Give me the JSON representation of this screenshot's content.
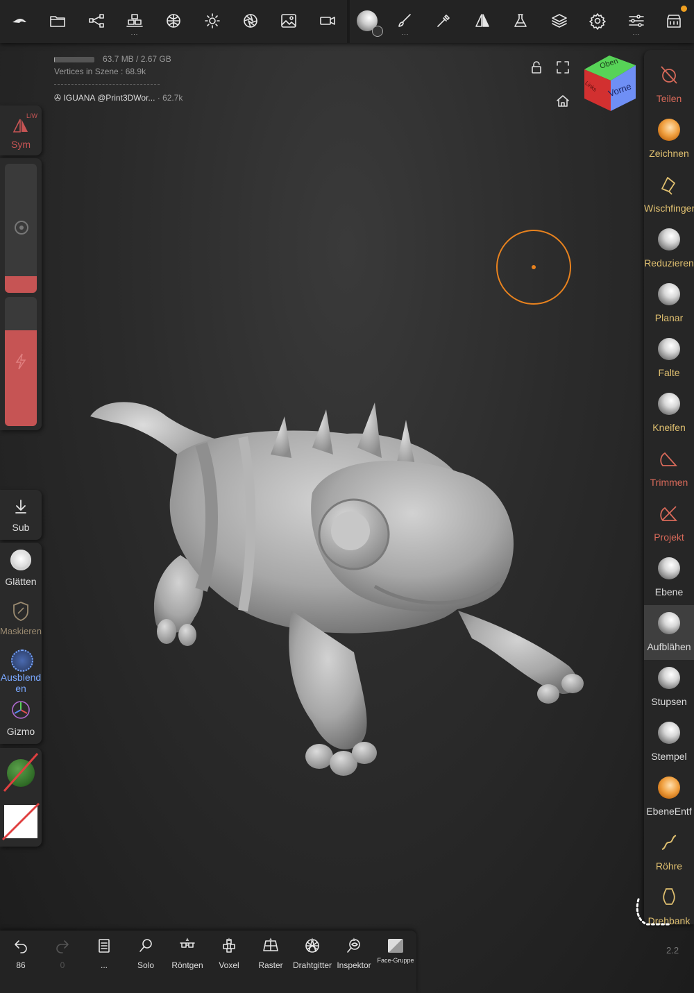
{
  "toolbar": {
    "items": [
      {
        "name": "nomad-logo-icon"
      },
      {
        "name": "files-icon"
      },
      {
        "name": "scene-tree-icon"
      },
      {
        "name": "scene-objects-icon"
      },
      {
        "name": "topology-icon"
      },
      {
        "name": "lighting-icon"
      },
      {
        "name": "camera-aperture-icon"
      },
      {
        "name": "background-image-icon"
      },
      {
        "name": "video-camera-icon"
      },
      {
        "name": "material-sphere-icon"
      },
      {
        "name": "paint-brush-icon"
      },
      {
        "name": "stroke-tool-icon"
      },
      {
        "name": "symmetry-icon"
      },
      {
        "name": "flask-icon"
      },
      {
        "name": "layers-icon"
      },
      {
        "name": "settings-gear-icon"
      },
      {
        "name": "sliders-icon"
      },
      {
        "name": "shop-icon"
      }
    ],
    "dots": "..."
  },
  "info": {
    "memory": "63.7 MB / 2.67 GB",
    "memory_fraction": 0.024,
    "vertices_label": "Vertices in Szene :",
    "vertices_value": "68.9k",
    "object_name": "IGUANA @Print3DWor...",
    "object_count": "· 62.7k"
  },
  "navcube": {
    "top": "Oben",
    "front": "Vorne",
    "left": "Links"
  },
  "left_panel": {
    "sym_label": "Sym",
    "sym_badge": "L/W",
    "radius_fraction": 0.13,
    "intensity_fraction": 0.74,
    "sub_label": "Sub",
    "glaetten_label": "Glätten",
    "maskieren_label": "Maskieren",
    "ausblenden_label": "Ausblend\nen",
    "gizmo_label": "Gizmo"
  },
  "tools": [
    {
      "label": "Teilen",
      "color": "#d96a5a",
      "icon": "split-icon"
    },
    {
      "label": "Zeichnen",
      "color": "#e0c070",
      "icon": "draw-sphere-icon"
    },
    {
      "label": "Wischfinger",
      "color": "#e0c070",
      "icon": "smudge-icon"
    },
    {
      "label": "Reduzieren",
      "color": "#e0c070",
      "icon": "flatten-sphere-icon"
    },
    {
      "label": "Planar",
      "color": "#e0c070",
      "icon": "planar-sphere-icon"
    },
    {
      "label": "Falte",
      "color": "#e0c070",
      "icon": "crease-sphere-icon"
    },
    {
      "label": "Kneifen",
      "color": "#e0c070",
      "icon": "pinch-sphere-icon"
    },
    {
      "label": "Trimmen",
      "color": "#d96a5a",
      "icon": "trim-icon"
    },
    {
      "label": "Projekt",
      "color": "#d96a5a",
      "icon": "project-icon"
    },
    {
      "label": "Ebene",
      "color": "#dddddd",
      "icon": "layer-sphere-icon"
    },
    {
      "label": "Aufblähen",
      "color": "#dddddd",
      "icon": "inflate-sphere-icon"
    },
    {
      "label": "Stupsen",
      "color": "#dddddd",
      "icon": "nudge-sphere-icon"
    },
    {
      "label": "Stempel",
      "color": "#dddddd",
      "icon": "stamp-sphere-icon"
    },
    {
      "label": "EbeneEntf",
      "color": "#dddddd",
      "icon": "layer-erase-icon"
    },
    {
      "label": "Röhre",
      "color": "#e0c070",
      "icon": "tube-icon"
    },
    {
      "label": "Drehbank",
      "color": "#e0c070",
      "icon": "lathe-icon"
    }
  ],
  "bottom": {
    "undo_count": "86",
    "redo_count": "0",
    "more_dots": "...",
    "solo": "Solo",
    "roentgen": "Röntgen",
    "voxel": "Voxel",
    "raster": "Raster",
    "drahtgitter": "Drahtgitter",
    "inspektor": "Inspektor",
    "face_gruppe": "Face-Gruppe"
  },
  "version": "2.2",
  "colors": {
    "accent_orange": "#e8821e",
    "red": "#c65454"
  }
}
